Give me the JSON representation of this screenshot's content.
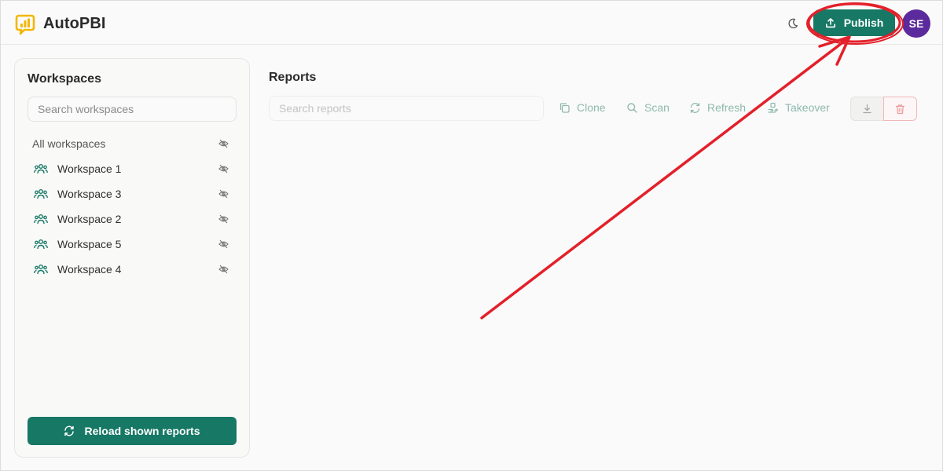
{
  "app": {
    "name": "AutoPBI"
  },
  "header": {
    "theme_icon": "moon-icon",
    "publish_label": "Publish",
    "avatar_initials": "SE",
    "colors": {
      "primary": "#167865",
      "avatar": "#5b2a9c"
    }
  },
  "sidebar": {
    "title": "Workspaces",
    "search_placeholder": "Search workspaces",
    "all_label": "All workspaces",
    "items": [
      {
        "label": "Workspace 1"
      },
      {
        "label": "Workspace 3"
      },
      {
        "label": "Workspace 2"
      },
      {
        "label": "Workspace 5"
      },
      {
        "label": "Workspace 4"
      }
    ],
    "reload_label": "Reload shown reports"
  },
  "main": {
    "title": "Reports",
    "search_placeholder": "Search reports",
    "toolbar": {
      "clone": "Clone",
      "scan": "Scan",
      "refresh": "Refresh",
      "takeover": "Takeover"
    }
  },
  "annotation": {
    "color": "#e3202a",
    "target": "publish-button"
  }
}
